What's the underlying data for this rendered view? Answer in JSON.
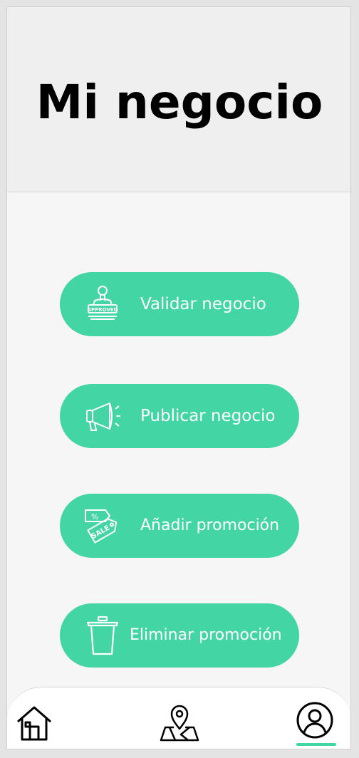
{
  "header": {
    "title": "Mi negocio"
  },
  "actions": [
    {
      "label": "Validar negocio",
      "icon": "approved-stamp-icon"
    },
    {
      "label": "Publicar negocio",
      "icon": "megaphone-icon"
    },
    {
      "label": "Añadir promoción",
      "icon": "sale-tag-icon"
    },
    {
      "label": "Eliminar promoción",
      "icon": "trash-icon"
    }
  ],
  "stamp_text": "APPROVED",
  "tag_text": "SALE",
  "tag_symbol": "%",
  "navbar": {
    "items": [
      {
        "icon": "home-icon"
      },
      {
        "icon": "map-pin-icon"
      },
      {
        "icon": "user-profile-icon",
        "active": true
      }
    ]
  },
  "colors": {
    "accent": "#43d5a3",
    "header_bg": "#efefef",
    "body_bg": "#f6f6f6"
  }
}
